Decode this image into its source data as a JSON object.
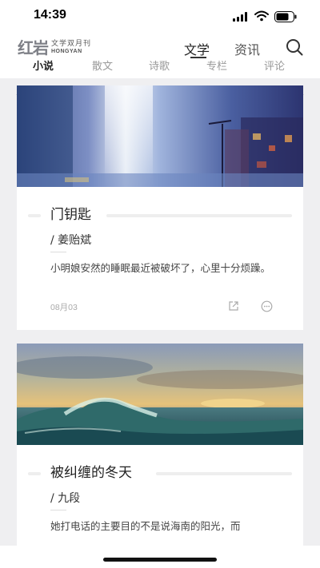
{
  "status_bar": {
    "time": "14:39"
  },
  "header": {
    "logo_mark": "红岩",
    "logo_cn": "文学双月刊",
    "logo_en": "HONGYAN",
    "nav": [
      {
        "label": "文学",
        "active": true
      },
      {
        "label": "资讯",
        "active": false
      }
    ],
    "search_icon": "search-icon"
  },
  "categories": [
    "小说",
    "散文",
    "诗歌",
    "专栏",
    "评论"
  ],
  "active_category": "小说",
  "articles": [
    {
      "title": "门钥匙",
      "author": "/ 姜贻斌",
      "excerpt": "小明娘安然的睡眠最近被破坏了，心里十分烦躁。",
      "date": "08月03",
      "image": "painting of a blue city street",
      "actions": [
        "share-icon",
        "comment-icon"
      ]
    },
    {
      "title": "被纠缠的冬天",
      "author": "/ 九段",
      "excerpt": "她打电话的主要目的不是说海南的阳光，而",
      "image": "painting of a sea wave at sunset"
    }
  ],
  "colors": {
    "accent": "#222222",
    "muted": "#999999",
    "background": "#efeff1"
  }
}
